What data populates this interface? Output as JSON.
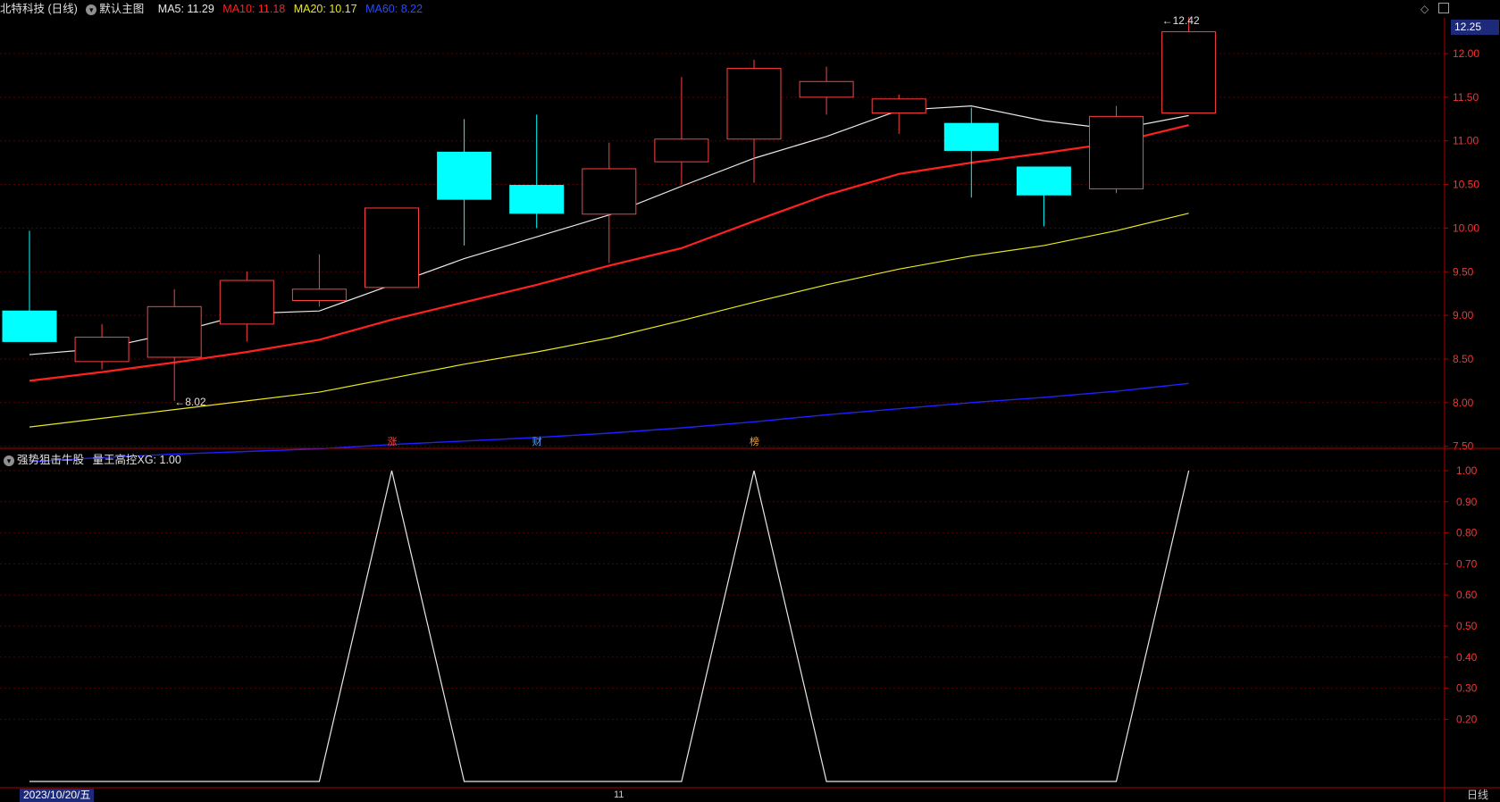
{
  "window": {
    "stock_label": "北特科技 (日线)",
    "template_label": "默认主图",
    "ma5": "MA5: 11.29",
    "ma10": "MA10: 11.18",
    "ma20": "MA20: 10.17",
    "ma60": "MA60: 8.22",
    "indicator_label": "强势狙击牛股",
    "indicator_value": "量王高控XG: 1.00",
    "current_price": "12.25",
    "cursor_date": "2023/10/20/五",
    "period_label": "日线",
    "month_tick": "11",
    "high_marker": "12.42",
    "low_marker": "8.02",
    "event_marks": [
      "涨",
      "财",
      "榜"
    ]
  },
  "colors": {
    "bg": "#000000",
    "grid": "#5a0000",
    "axis": "#b00000",
    "up": "#ff4040",
    "down": "#00ffff",
    "ma5": "#e8e8e8",
    "ma10": "#ff2020",
    "ma20": "#e8e820",
    "ma60": "#2020ff"
  },
  "chart_data": [
    {
      "type": "candlestick",
      "title": "北特科技 (日线)",
      "ylim": [
        7.2,
        12.5
      ],
      "y_ticks": [
        12.0,
        11.5,
        11.0,
        10.5,
        10.0,
        9.5,
        9.0,
        8.5,
        8.0,
        7.5
      ],
      "candles": [
        {
          "open": 9.05,
          "close": 8.7,
          "high": 9.97,
          "low": 8.7
        },
        {
          "open": 8.47,
          "close": 8.75,
          "high": 8.9,
          "low": 8.38
        },
        {
          "open": 8.52,
          "close": 9.1,
          "high": 9.3,
          "low": 8.02
        },
        {
          "open": 8.9,
          "close": 9.4,
          "high": 9.5,
          "low": 8.7
        },
        {
          "open": 9.17,
          "close": 9.3,
          "high": 9.7,
          "low": 9.1
        },
        {
          "open": 9.32,
          "close": 10.23,
          "high": 10.23,
          "low": 9.32
        },
        {
          "open": 10.87,
          "close": 10.33,
          "high": 11.25,
          "low": 9.8
        },
        {
          "open": 10.49,
          "close": 10.17,
          "high": 11.3,
          "low": 10.0
        },
        {
          "open": 10.16,
          "close": 10.68,
          "high": 10.98,
          "low": 9.6
        },
        {
          "open": 10.76,
          "close": 11.02,
          "high": 11.73,
          "low": 10.5
        },
        {
          "open": 11.02,
          "close": 11.83,
          "high": 11.93,
          "low": 10.52
        },
        {
          "open": 11.5,
          "close": 11.68,
          "high": 11.85,
          "low": 11.3
        },
        {
          "open": 11.32,
          "close": 11.48,
          "high": 11.53,
          "low": 11.08
        },
        {
          "open": 11.2,
          "close": 10.89,
          "high": 11.38,
          "low": 10.35
        },
        {
          "open": 10.7,
          "close": 10.38,
          "high": 10.7,
          "low": 10.02
        },
        {
          "open": 10.45,
          "close": 11.28,
          "high": 11.4,
          "low": 10.4
        },
        {
          "open": 11.32,
          "close": 12.25,
          "high": 12.42,
          "low": 11.32
        }
      ],
      "series": [
        {
          "name": "MA5",
          "values": [
            8.55,
            8.62,
            8.8,
            9.02,
            9.05,
            9.35,
            9.65,
            9.9,
            10.15,
            10.48,
            10.8,
            11.05,
            11.35,
            11.4,
            11.23,
            11.13,
            11.29
          ]
        },
        {
          "name": "MA10",
          "values": [
            8.25,
            8.35,
            8.46,
            8.58,
            8.72,
            8.95,
            9.15,
            9.35,
            9.57,
            9.77,
            10.08,
            10.38,
            10.62,
            10.75,
            10.86,
            10.98,
            11.18
          ]
        },
        {
          "name": "MA20",
          "values": [
            7.72,
            7.82,
            7.92,
            8.02,
            8.12,
            8.28,
            8.44,
            8.58,
            8.74,
            8.94,
            9.15,
            9.35,
            9.53,
            9.68,
            9.8,
            9.97,
            10.17
          ]
        },
        {
          "name": "MA60",
          "values": [
            7.32,
            7.37,
            7.41,
            7.44,
            7.47,
            7.52,
            7.56,
            7.6,
            7.65,
            7.71,
            7.78,
            7.86,
            7.93,
            8.0,
            8.06,
            8.13,
            8.22
          ]
        }
      ]
    },
    {
      "type": "line",
      "title": "强势狙击牛股",
      "ylim": [
        0,
        1.05
      ],
      "y_ticks": [
        1.0,
        0.9,
        0.8,
        0.7,
        0.6,
        0.5,
        0.4,
        0.3,
        0.2
      ],
      "series": [
        {
          "name": "量王高控XG",
          "values": [
            0,
            0,
            0,
            0,
            0,
            1,
            0,
            0,
            0,
            0,
            1,
            0,
            0,
            0,
            0,
            0,
            1
          ]
        }
      ]
    }
  ]
}
